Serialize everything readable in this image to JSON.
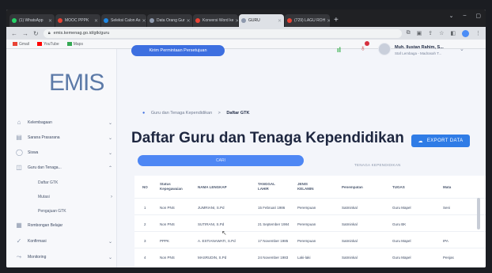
{
  "browser": {
    "tabs": [
      {
        "label": "(1) WhatsApp",
        "color": "#25d366"
      },
      {
        "label": "MOOC PPPK",
        "color": "#e94335"
      },
      {
        "label": "Seleksi Calon As",
        "color": "#1e88e5"
      },
      {
        "label": "Data Orang Gur",
        "color": "#8e99ad"
      },
      {
        "label": "Konversi Word ke",
        "color": "#e94335"
      },
      {
        "label": "GURU",
        "color": "#8e99ad",
        "active": true
      },
      {
        "label": "(729) LAGU ROH",
        "color": "#e94335"
      }
    ],
    "new_tab": "+",
    "window_controls": [
      "⌄",
      "–",
      "▢"
    ],
    "url": "emis.kemenag.go.id/gtk/guru"
  },
  "bookmarks": [
    {
      "label": "Gmail",
      "color": "#e94335"
    },
    {
      "label": "YouTube",
      "color": "#ff0000"
    },
    {
      "label": "Maps",
      "color": "#34a853"
    }
  ],
  "sidebar": {
    "logo": "EMIS",
    "items": [
      {
        "label": "Kelembagaan",
        "icon": "⌂",
        "chev": "⌄"
      },
      {
        "label": "Sarana Prasarana",
        "icon": "▤",
        "chev": "⌄"
      },
      {
        "label": "Siswa",
        "icon": "◯",
        "chev": "⌄"
      },
      {
        "label": "Guru dan Tenaga...",
        "icon": "◫",
        "chev": "⌃"
      }
    ],
    "subitems": [
      {
        "label": "Daftar GTK",
        "chev": ""
      },
      {
        "label": "Mutasi",
        "chev": "›"
      },
      {
        "label": "Pengajuan GTK",
        "chev": ""
      }
    ],
    "items_bottom": [
      {
        "label": "Rombongan Belajar",
        "icon": "▦",
        "chev": ""
      },
      {
        "label": "Konfirmasi",
        "icon": "✓",
        "chev": "⌄"
      },
      {
        "label": "Monitoring",
        "icon": "⤳",
        "chev": "⌄"
      }
    ]
  },
  "header": {
    "request_button": "Kirim Permintaan Persetujuan",
    "user_name": "Muh. Ilustan Rahim, S...",
    "user_role": "Staf Lembaga - Madrasah T..."
  },
  "breadcrumb": {
    "parent": "Guru dan Tenaga Kependidikan",
    "separator": ">",
    "current": "Daftar GTK"
  },
  "page_title": "Daftar Guru dan Tenaga Kependidikan",
  "export_button": "EXPORT DATA",
  "search_button": "CARI",
  "filter_label": "TENAGA KEPENDIDIKAN",
  "table": {
    "headers": [
      "NO",
      "Status Kepegawaian",
      "NAMA LENGKAP",
      "TANGGAL LAHIR",
      "JENIS KELAMIN",
      "Penempatan",
      "TUGAS",
      "Mata"
    ],
    "rows": [
      [
        "1",
        "Non PNS",
        "JUMRIANI, S.Pd",
        "15 Februari 1986",
        "Perempuan",
        "Satminkal",
        "Guru Mapel",
        "Seni"
      ],
      [
        "2",
        "Non PNS",
        "SUTIRANI, S.Pd",
        "21 September 1984",
        "Perempuan",
        "Satminkal",
        "Guru BK",
        ""
      ],
      [
        "3",
        "PPPK",
        "A. ESTIANAWATI, S.Pd",
        "17 November 1985",
        "Perempuan",
        "Satminkal",
        "Guru Mapel",
        "IPA"
      ],
      [
        "4",
        "Non PNS",
        "MASRUDIN, S.Pd",
        "24 November 1983",
        "Laki-laki",
        "Satminkal",
        "Guru Mapel",
        "Penjas"
      ]
    ]
  }
}
